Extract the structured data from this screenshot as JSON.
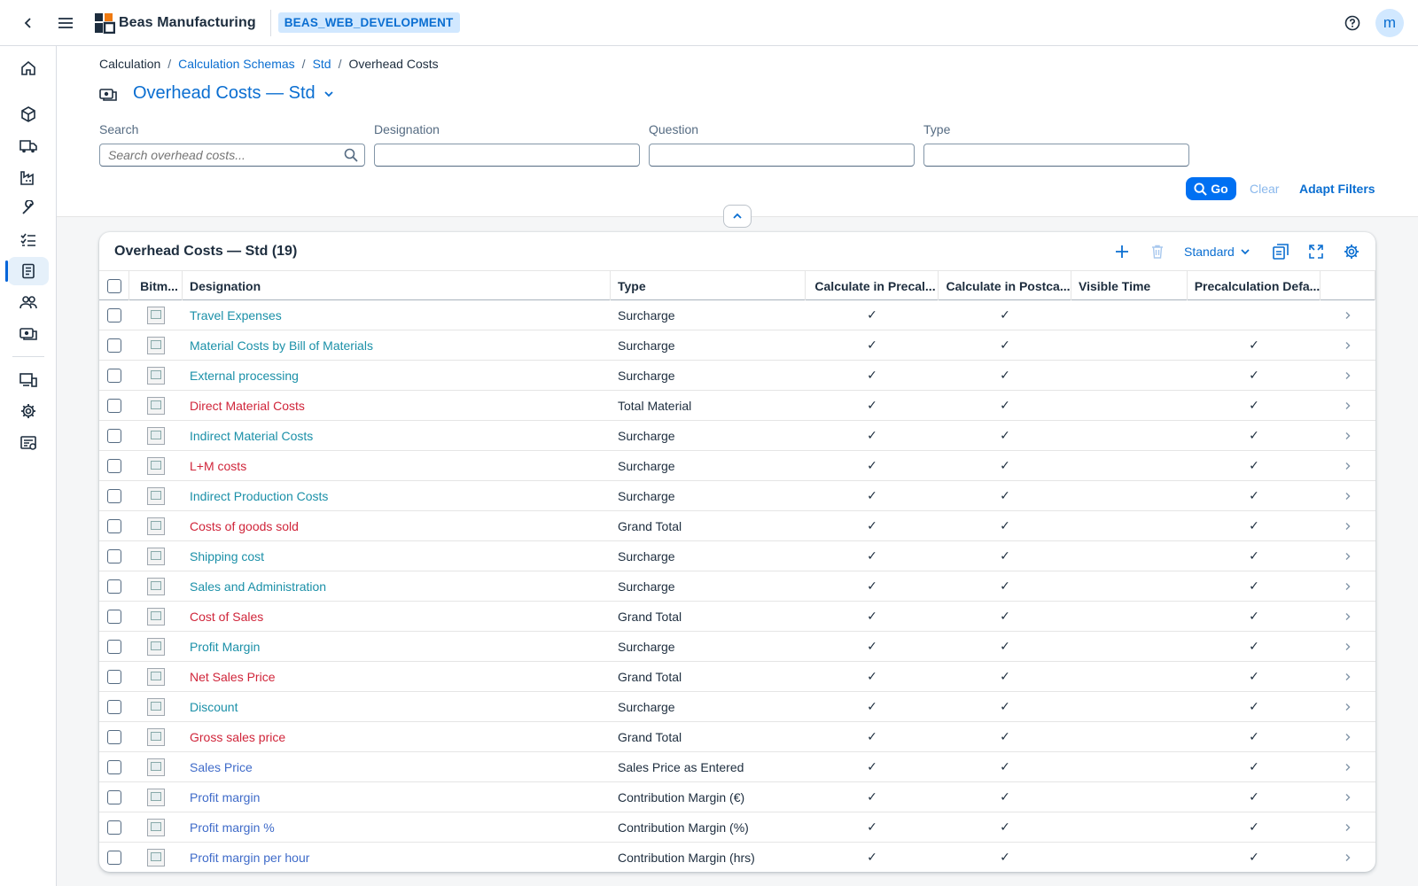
{
  "app": {
    "brand": "Beas Manufacturing",
    "environment": "BEAS_WEB_DEVELOPMENT",
    "user_initial": "m"
  },
  "breadcrumb": {
    "items": [
      "Calculation",
      "Calculation Schemas",
      "Std"
    ],
    "current": "Overhead Costs"
  },
  "page": {
    "title": "Overhead Costs — Std"
  },
  "filters": {
    "search": {
      "label": "Search",
      "placeholder": "Search overhead costs..."
    },
    "designation": {
      "label": "Designation",
      "value": ""
    },
    "question": {
      "label": "Question",
      "value": ""
    },
    "type": {
      "label": "Type",
      "value": ""
    },
    "go": "Go",
    "clear": "Clear",
    "adapt": "Adapt Filters"
  },
  "table": {
    "title": "Overhead Costs — Std (19)",
    "variant": "Standard",
    "columns": [
      "Bitm...",
      "Designation",
      "Type",
      "Calculate in Precal...",
      "Calculate in Postca...",
      "Visible Time",
      "Precalculation Defa..."
    ],
    "check_glyph": "✓",
    "nav_glyph": "›",
    "rows": [
      {
        "designation": "Travel Expenses",
        "type": "Surcharge",
        "color": "#1b90a8",
        "pre": true,
        "post": true,
        "pdef": false
      },
      {
        "designation": "Material Costs by Bill of Materials",
        "type": "Surcharge",
        "color": "#1b90a8",
        "pre": true,
        "post": true,
        "pdef": true
      },
      {
        "designation": "External processing",
        "type": "Surcharge",
        "color": "#1b90a8",
        "pre": true,
        "post": true,
        "pdef": true
      },
      {
        "designation": "Direct Material Costs",
        "type": "Total Material",
        "color": "#d0253a",
        "pre": true,
        "post": true,
        "pdef": true
      },
      {
        "designation": "Indirect Material Costs",
        "type": "Surcharge",
        "color": "#1b90a8",
        "pre": true,
        "post": true,
        "pdef": true
      },
      {
        "designation": "L+M costs",
        "type": "Surcharge",
        "color": "#d0253a",
        "pre": true,
        "post": true,
        "pdef": true
      },
      {
        "designation": "Indirect Production Costs",
        "type": "Surcharge",
        "color": "#1b90a8",
        "pre": true,
        "post": true,
        "pdef": true
      },
      {
        "designation": "Costs of goods sold",
        "type": "Grand Total",
        "color": "#d0253a",
        "pre": true,
        "post": true,
        "pdef": true
      },
      {
        "designation": "Shipping cost",
        "type": "Surcharge",
        "color": "#1b90a8",
        "pre": true,
        "post": true,
        "pdef": true
      },
      {
        "designation": "Sales and Administration",
        "type": "Surcharge",
        "color": "#1b90a8",
        "pre": true,
        "post": true,
        "pdef": true
      },
      {
        "designation": "Cost of Sales",
        "type": "Grand Total",
        "color": "#d0253a",
        "pre": true,
        "post": true,
        "pdef": true
      },
      {
        "designation": "Profit Margin",
        "type": "Surcharge",
        "color": "#1b90a8",
        "pre": true,
        "post": true,
        "pdef": true
      },
      {
        "designation": "Net Sales Price",
        "type": "Grand Total",
        "color": "#d0253a",
        "pre": true,
        "post": true,
        "pdef": true
      },
      {
        "designation": "Discount",
        "type": "Surcharge",
        "color": "#1b90a8",
        "pre": true,
        "post": true,
        "pdef": true
      },
      {
        "designation": "Gross sales price",
        "type": "Grand Total",
        "color": "#d0253a",
        "pre": true,
        "post": true,
        "pdef": true
      },
      {
        "designation": "Sales Price",
        "type": "Sales Price as Entered",
        "color": "#3f6bc9",
        "pre": true,
        "post": true,
        "pdef": true
      },
      {
        "designation": "Profit margin",
        "type": "Contribution Margin (€)",
        "color": "#3f6bc9",
        "pre": true,
        "post": true,
        "pdef": true
      },
      {
        "designation": "Profit margin %",
        "type": "Contribution Margin (%)",
        "color": "#3f6bc9",
        "pre": true,
        "post": true,
        "pdef": true
      },
      {
        "designation": "Profit margin per hour",
        "type": "Contribution Margin (hrs)",
        "color": "#3f6bc9",
        "pre": true,
        "post": true,
        "pdef": true
      }
    ]
  },
  "sidenav": {
    "items": [
      "home-icon",
      "cube-icon",
      "truck-icon",
      "factory-icon",
      "wrench-icon",
      "checklist-icon",
      "calculator-icon",
      "users-icon",
      "money-icon",
      "devices-icon",
      "gear-icon",
      "report-icon"
    ],
    "active": "calculator-icon"
  }
}
